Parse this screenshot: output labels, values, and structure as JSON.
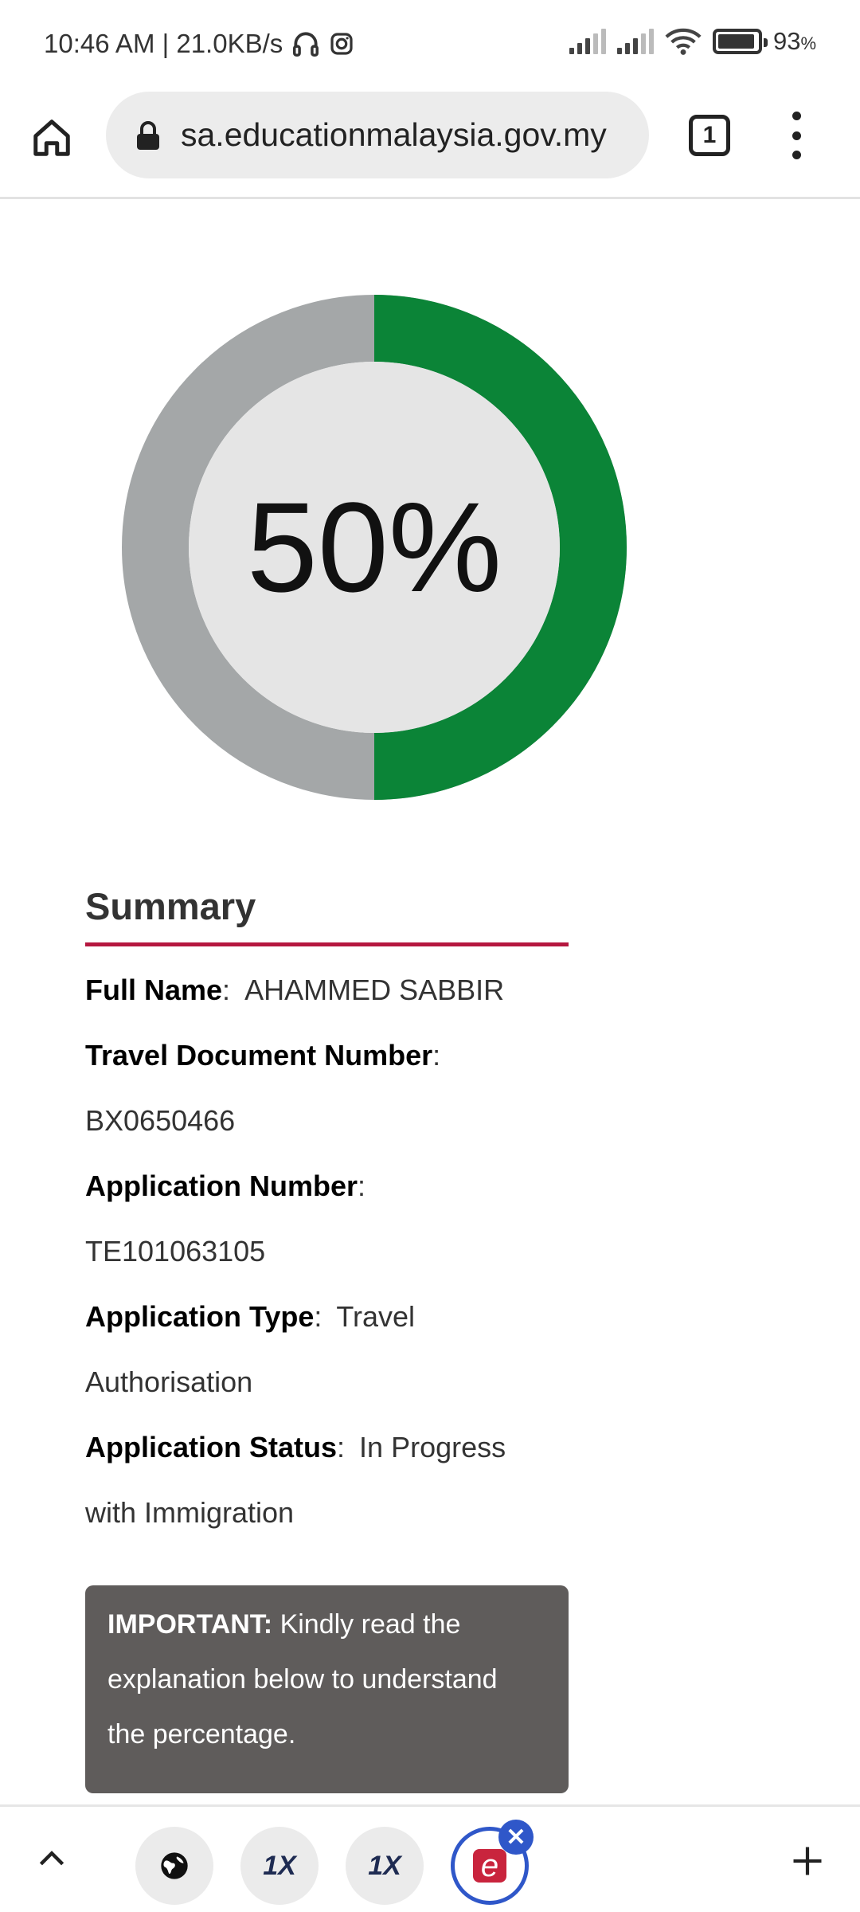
{
  "status_bar": {
    "time_speed": "10:46 AM | 21.0KB/s",
    "battery": "93",
    "battery_unit": "%"
  },
  "browser": {
    "url": "sa.educationmalaysia.gov.my",
    "tab_count": "1"
  },
  "progress": {
    "label": "50%",
    "value": 0.5,
    "colors": {
      "done": "#0b8437",
      "remaining": "#a4a7a8",
      "center": "#e5e5e5"
    }
  },
  "summary": {
    "title": "Summary",
    "full_name_label": "Full Name",
    "full_name": "AHAMMED SABBIR",
    "travel_doc_label": "Travel Document Number",
    "travel_doc": "BX0650466",
    "app_number_label": "Application Number",
    "app_number": "TE101063105",
    "app_type_label": "Application Type",
    "app_type_line1": "Travel",
    "app_type_line2": "Authorisation",
    "app_status_label": "Application Status",
    "app_status_line1": "In Progress",
    "app_status_line2": "with Immigration",
    "colon": ":"
  },
  "important": {
    "lead": "IMPORTANT:",
    "line1": "Kindly read the",
    "line2": "explanation below to understand",
    "line3": "the percentage."
  },
  "bottom_bar": {
    "tab2_label": "1X",
    "tab3_label": "1X",
    "tab4_label": "e"
  }
}
